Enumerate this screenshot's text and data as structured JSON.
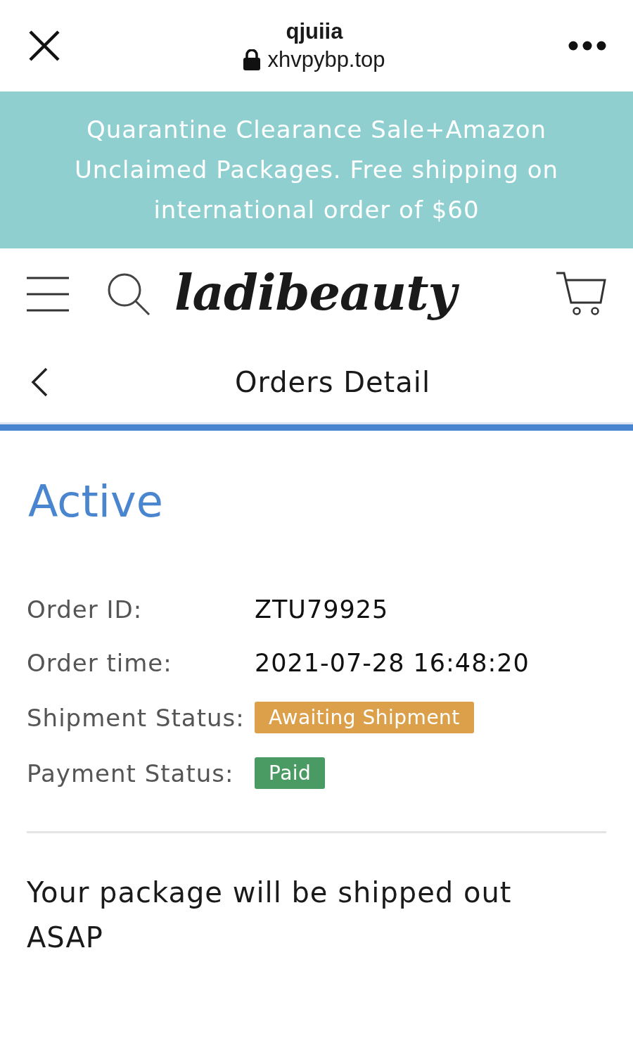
{
  "browser_bar": {
    "title": "qjuiia",
    "url": "xhvpybp.top"
  },
  "announcement": "Quarantine Clearance Sale+Amazon Unclaimed Packages. Free shipping on international order of $60",
  "header": {
    "logo": "ladibeauty"
  },
  "page_title": "Orders Detail",
  "order": {
    "status": "Active",
    "fields": [
      {
        "label": "Order ID:",
        "kind": "text",
        "value": "ZTU79925"
      },
      {
        "label": "Order time:",
        "kind": "text",
        "value": "2021-07-28 16:48:20"
      },
      {
        "label": "Shipment Status:",
        "kind": "badge",
        "value": "Awaiting Shipment",
        "color": "#dca04b"
      },
      {
        "label": "Payment Status:",
        "kind": "badge",
        "value": "Paid",
        "color": "#4a9a63"
      }
    ],
    "message": "Your package will be shipped out ASAP"
  }
}
